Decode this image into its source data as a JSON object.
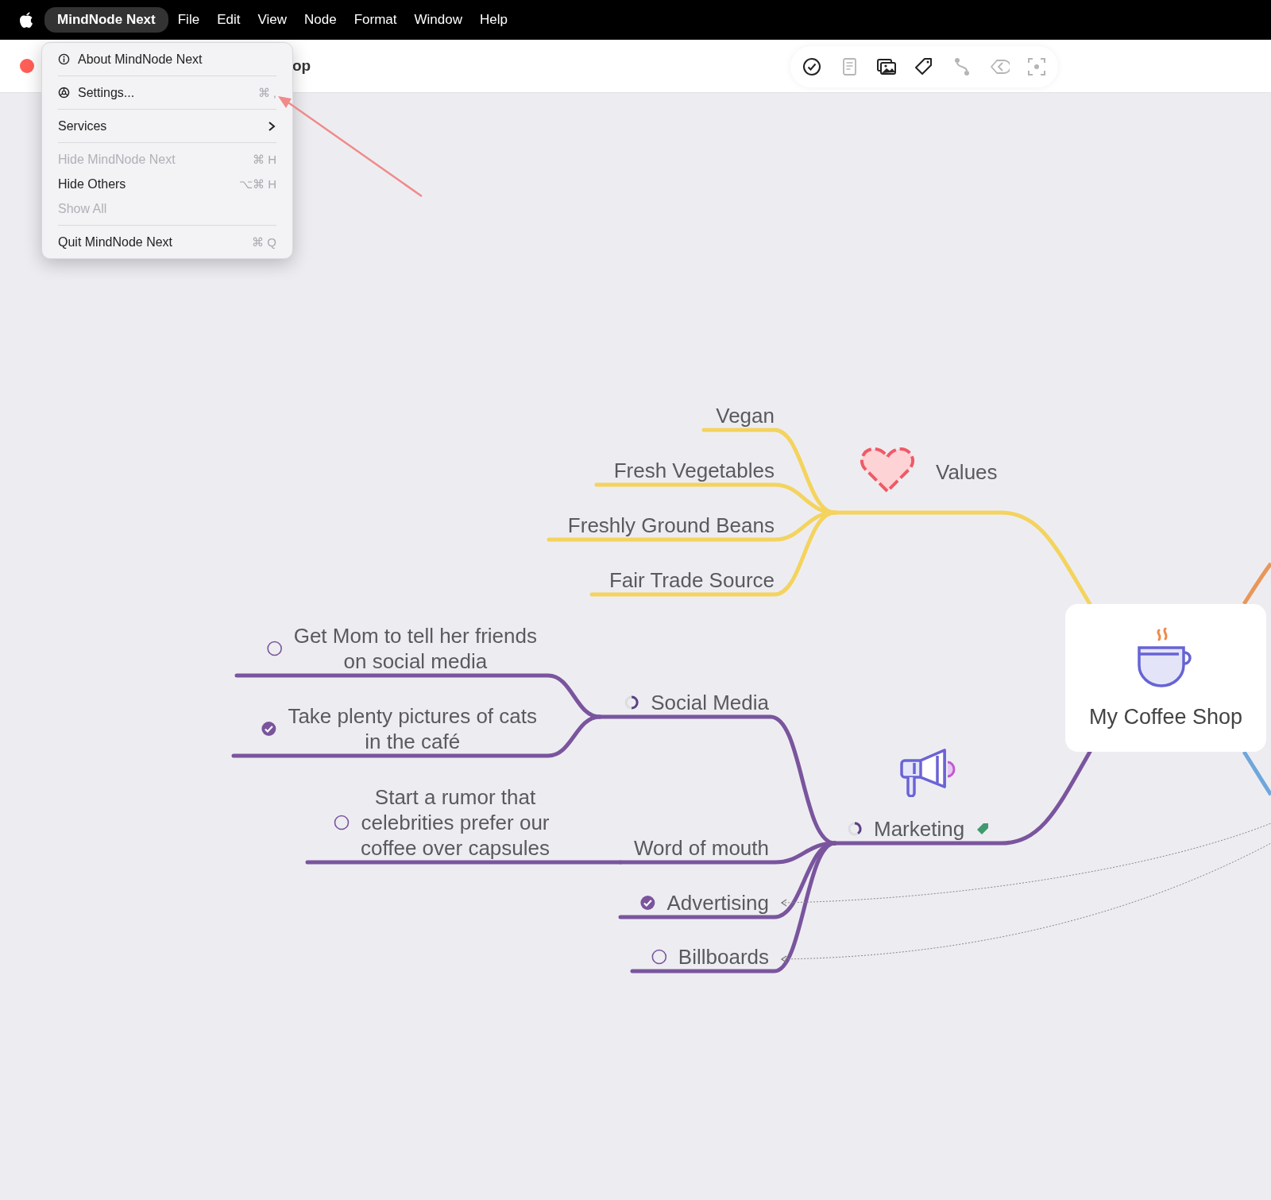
{
  "menu_bar": {
    "items": [
      {
        "label": "MindNode Next",
        "selected": true
      },
      {
        "label": "File",
        "selected": false
      },
      {
        "label": "Edit",
        "selected": false
      },
      {
        "label": "View",
        "selected": false
      },
      {
        "label": "Node",
        "selected": false
      },
      {
        "label": "Format",
        "selected": false
      },
      {
        "label": "Window",
        "selected": false
      },
      {
        "label": "Help",
        "selected": false
      }
    ]
  },
  "app_menu": {
    "groups": [
      [
        {
          "kind": "about",
          "label": "About MindNode Next",
          "disabled": false
        }
      ],
      [
        {
          "kind": "settings",
          "label": "Settings...",
          "shortcut": "⌘ ,",
          "disabled": false
        }
      ],
      [
        {
          "kind": "submenu",
          "label": "Services",
          "disabled": false
        }
      ],
      [
        {
          "kind": "command",
          "label": "Hide MindNode Next",
          "shortcut": "⌘ H",
          "disabled": true
        },
        {
          "kind": "command",
          "label": "Hide Others",
          "shortcut": "⌥⌘ H",
          "disabled": false
        },
        {
          "kind": "command",
          "label": "Show All",
          "disabled": true
        }
      ],
      [
        {
          "kind": "command",
          "label": "Quit MindNode Next",
          "shortcut": "⌘ Q",
          "disabled": false
        }
      ]
    ]
  },
  "window": {
    "title": "op"
  },
  "toolbar": {
    "buttons": [
      {
        "kind": "task",
        "disabled": false
      },
      {
        "kind": "note",
        "disabled": true
      },
      {
        "kind": "image",
        "disabled": false
      },
      {
        "kind": "tag",
        "disabled": false
      },
      {
        "kind": "connection",
        "disabled": true
      },
      {
        "kind": "back",
        "disabled": true
      },
      {
        "kind": "focus",
        "disabled": true
      }
    ]
  },
  "mind_map": {
    "root": {
      "title": "My Coffee Shop"
    },
    "branches": [
      {
        "title": "Values",
        "color": "#f4d35e",
        "children": [
          {
            "title": "Vegan"
          },
          {
            "title": "Fresh Vegetables"
          },
          {
            "title": "Freshly Ground Beans"
          },
          {
            "title": "Fair Trade Source"
          }
        ]
      },
      {
        "title": "Marketing",
        "color": "#7a559e",
        "level": 0.4,
        "tagged": true,
        "children": [
          {
            "title": "Social Media",
            "level": 0.5,
            "children": [
              {
                "title": "Get Mom to tell her friends\non social media",
                "checked": false
              },
              {
                "title": "Take plenty pictures of cats\nin the café",
                "checked": true
              }
            ]
          },
          {
            "title": "Word of mouth",
            "children": [
              {
                "title": "Start a rumor that\ncelebrities prefer our\ncoffee over capsules",
                "checked": false
              }
            ]
          },
          {
            "title": "Advertising",
            "checked": true
          },
          {
            "title": "Billboards",
            "checked": false
          }
        ]
      }
    ]
  }
}
